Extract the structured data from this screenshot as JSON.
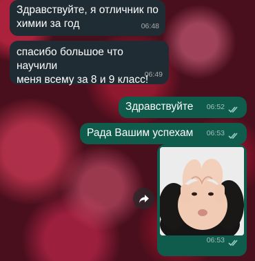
{
  "chat": {
    "messages": [
      {
        "direction": "incoming",
        "text_line1": "Здравствуйте, я отличник по",
        "text_line2": "химии за год",
        "time": "06:48"
      },
      {
        "direction": "incoming",
        "text_line1": "спасибо большое что научили",
        "text_line2": "меня всему за 8 и 9 класс!",
        "time": "06:49"
      },
      {
        "direction": "outgoing",
        "text": "Здравствуйте",
        "time": "06:52",
        "status": "read"
      },
      {
        "direction": "outgoing",
        "text": "Рада Вашим успехам",
        "time": "06:53",
        "status": "read"
      },
      {
        "direction": "outgoing",
        "type": "sticker",
        "sticker_icon": "child-heart-hands-sticker",
        "time": "06:53",
        "status": "read"
      }
    ]
  },
  "controls": {
    "forward_icon": "forward-arrow-icon"
  },
  "colors": {
    "incoming_bubble": "#1f2c33",
    "outgoing_bubble": "#0f5c4c",
    "read_checks": "#9ad1c6"
  }
}
